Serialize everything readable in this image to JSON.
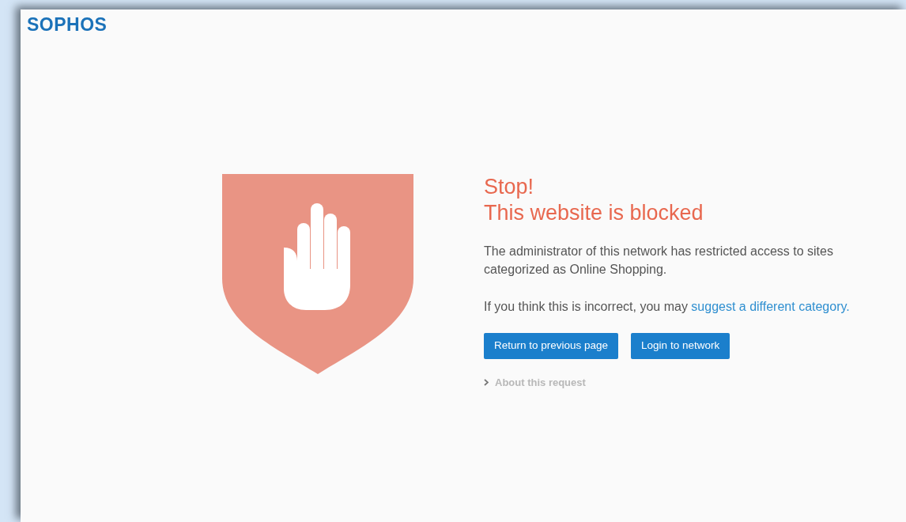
{
  "logo": "SOPHOS",
  "heading": [
    "Stop!",
    "This website is blocked"
  ],
  "message": "The administrator of this network has restricted access to sites categorized as Online Shopping.",
  "prompt": {
    "text": "If you think this is incorrect, you may",
    "link": "suggest a different category."
  },
  "buttons": [
    "Return to previous page",
    "Login to network"
  ],
  "details": {
    "label": "About this request",
    "expanded": false
  }
}
